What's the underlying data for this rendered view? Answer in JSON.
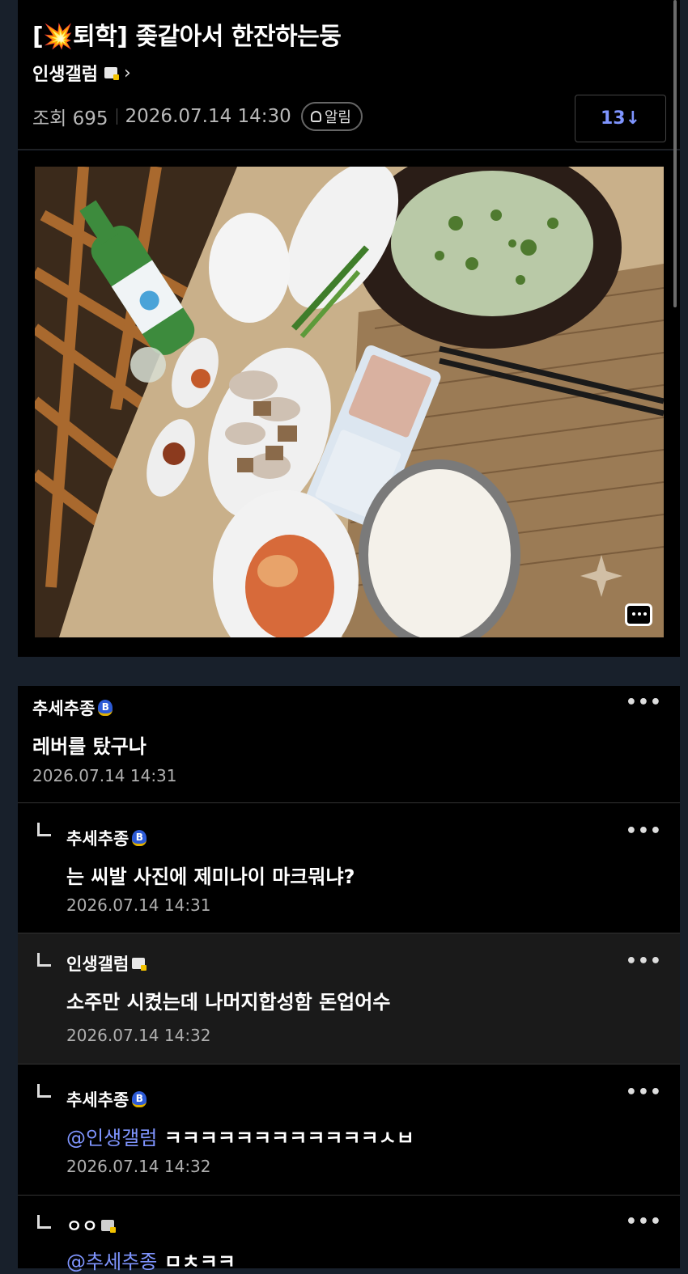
{
  "post": {
    "title_tag": "[",
    "title_tag_emoji": "💥",
    "title_tag_rest": "퇴학]",
    "title_text": "좆같아서 한잔하는둥",
    "author": "인생갤럼",
    "views_label": "조회 695",
    "datetime": "2026.07.14 14:30",
    "alarm_label": "알림",
    "comment_count_label": "13↓"
  },
  "comments": [
    {
      "author": "추세추종",
      "text": "레버를 탔구나",
      "time": "2026.07.14 14:31"
    },
    {
      "author": "추세추종",
      "text": "는 씨발 사진에 제미나이 마크뭐냐?",
      "time": "2026.07.14 14:31"
    },
    {
      "author": "인생갤럼",
      "text": "소주만 시켰는데 나머지합성함 돈업어수",
      "time": "2026.07.14 14:32"
    },
    {
      "author": "추세추종",
      "mention": "@인생갤럼",
      "text": "ㅋㅋㅋㅋㅋㅋㅋㅋㅋㅋㅋㅋㅅㅂ",
      "time": "2026.07.14 14:32"
    },
    {
      "author": "ㅇㅇ",
      "mention": "@추세추종",
      "text": "ㅁㅊㅋㅋ"
    }
  ],
  "ui": {
    "more_label": "•••"
  }
}
